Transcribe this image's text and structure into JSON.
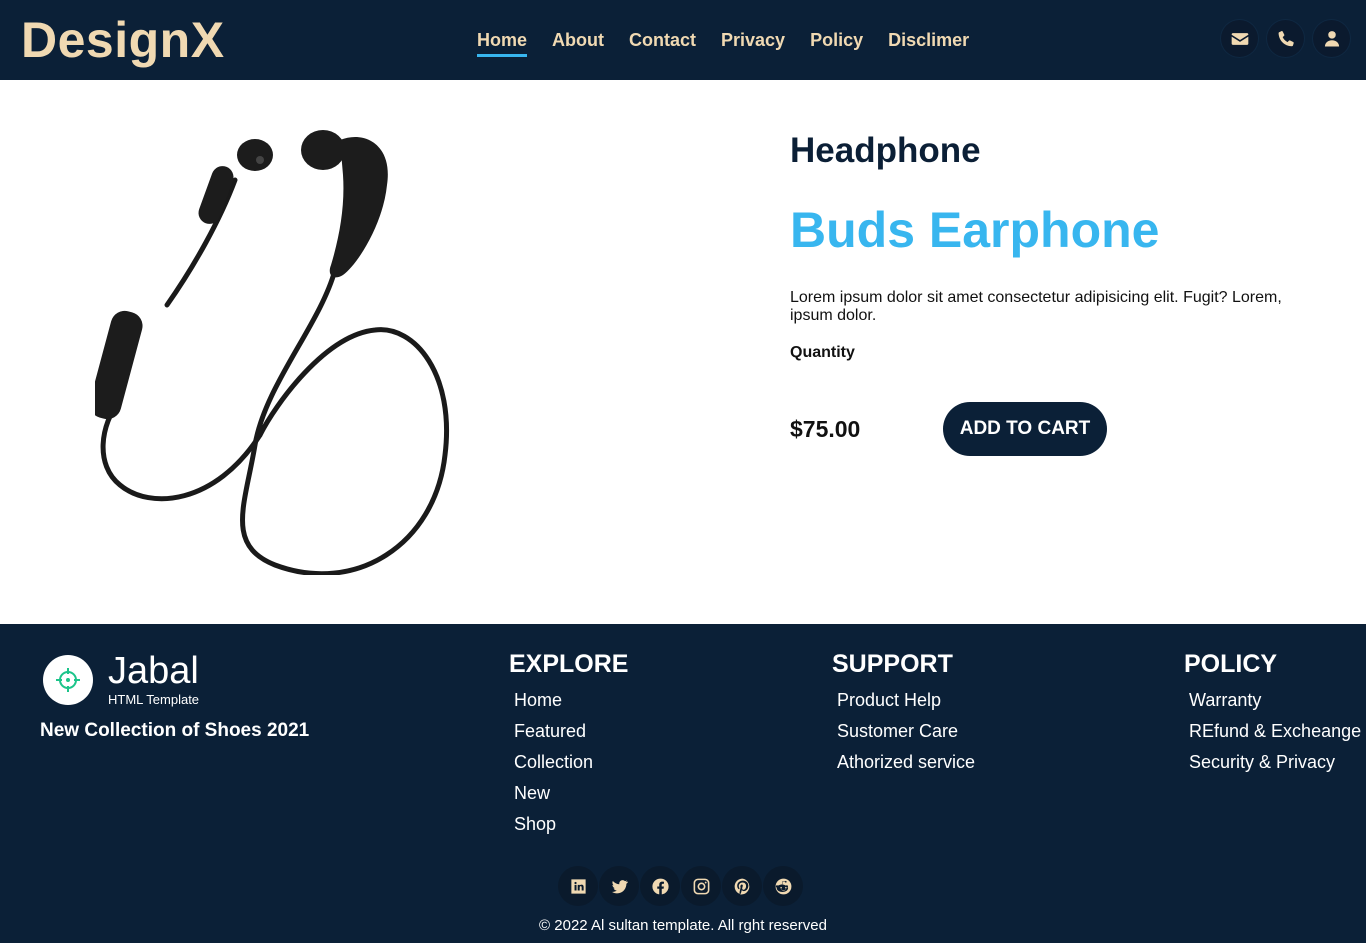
{
  "header": {
    "brand": "DesignX",
    "nav": [
      {
        "label": "Home",
        "active": true
      },
      {
        "label": "About"
      },
      {
        "label": "Contact"
      },
      {
        "label": "Privacy"
      },
      {
        "label": "Policy"
      },
      {
        "label": "Disclimer"
      }
    ],
    "icons": [
      "envelope-icon",
      "phone-icon",
      "user-icon"
    ],
    "accent": "#38b6ef",
    "brand_color": "#f0d9b2",
    "background": "#0b2037"
  },
  "product": {
    "category": "Headphone",
    "name": "Buds Earphone",
    "description": "Lorem ipsum dolor sit amet consectetur adipisicing elit. Fugit? Lorem, ipsum dolor.",
    "quantity_label": "Quantity",
    "price": "$75.00",
    "cart_button": "ADD TO CART",
    "image_icon": "earphone-image"
  },
  "footer": {
    "logo": {
      "name": "Jabal",
      "subtitle": "HTML Template"
    },
    "tagline": "New Collection of Shoes 2021",
    "columns": [
      {
        "title": "EXPLORE",
        "links": [
          "Home",
          "Featured",
          "Collection",
          "New",
          "Shop"
        ]
      },
      {
        "title": "SUPPORT",
        "links": [
          "Product Help",
          "Sustomer Care",
          "Athorized service"
        ]
      },
      {
        "title": "POLICY",
        "links": [
          "Warranty",
          "REfund & Excheange",
          "Security & Privacy"
        ]
      }
    ],
    "social": [
      "linkedin-icon",
      "twitter-icon",
      "facebook-icon",
      "instagram-icon",
      "pinterest-icon",
      "reddit-icon"
    ],
    "copyright": "© 2022 Al sultan template. All rght reserved"
  }
}
